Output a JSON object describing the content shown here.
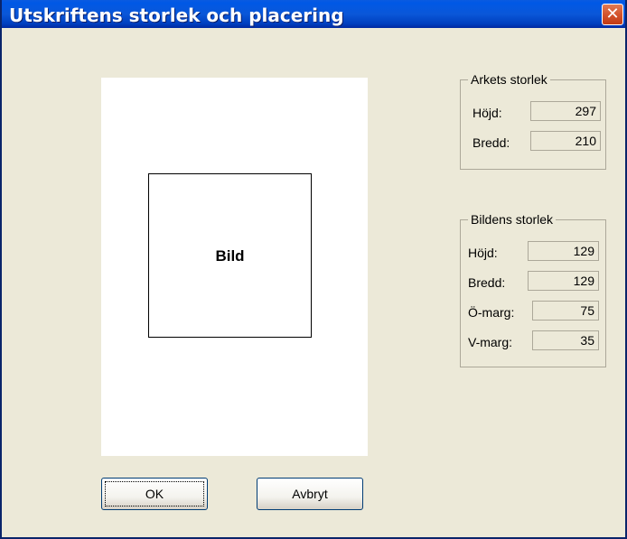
{
  "window": {
    "title": "Utskriftens storlek och placering",
    "close_glyph": "✕"
  },
  "preview": {
    "image_label": "Bild"
  },
  "sheet_size": {
    "title": "Arkets storlek",
    "height_label": "Höjd:",
    "height_value": "297",
    "width_label": "Bredd:",
    "width_value": "210"
  },
  "image_size": {
    "title": "Bildens storlek",
    "height_label": "Höjd:",
    "height_value": "129",
    "width_label": "Bredd:",
    "width_value": "129",
    "top_margin_label": "Ö-marg:",
    "top_margin_value": "75",
    "left_margin_label": "V-marg:",
    "left_margin_value": "35"
  },
  "buttons": {
    "ok": "OK",
    "cancel": "Avbryt"
  },
  "colors": {
    "dialog_bg": "#ECE9D8",
    "titlebar": "#0A57D8",
    "close_button": "#D4542C"
  },
  "icons": {
    "close": "close-icon"
  }
}
